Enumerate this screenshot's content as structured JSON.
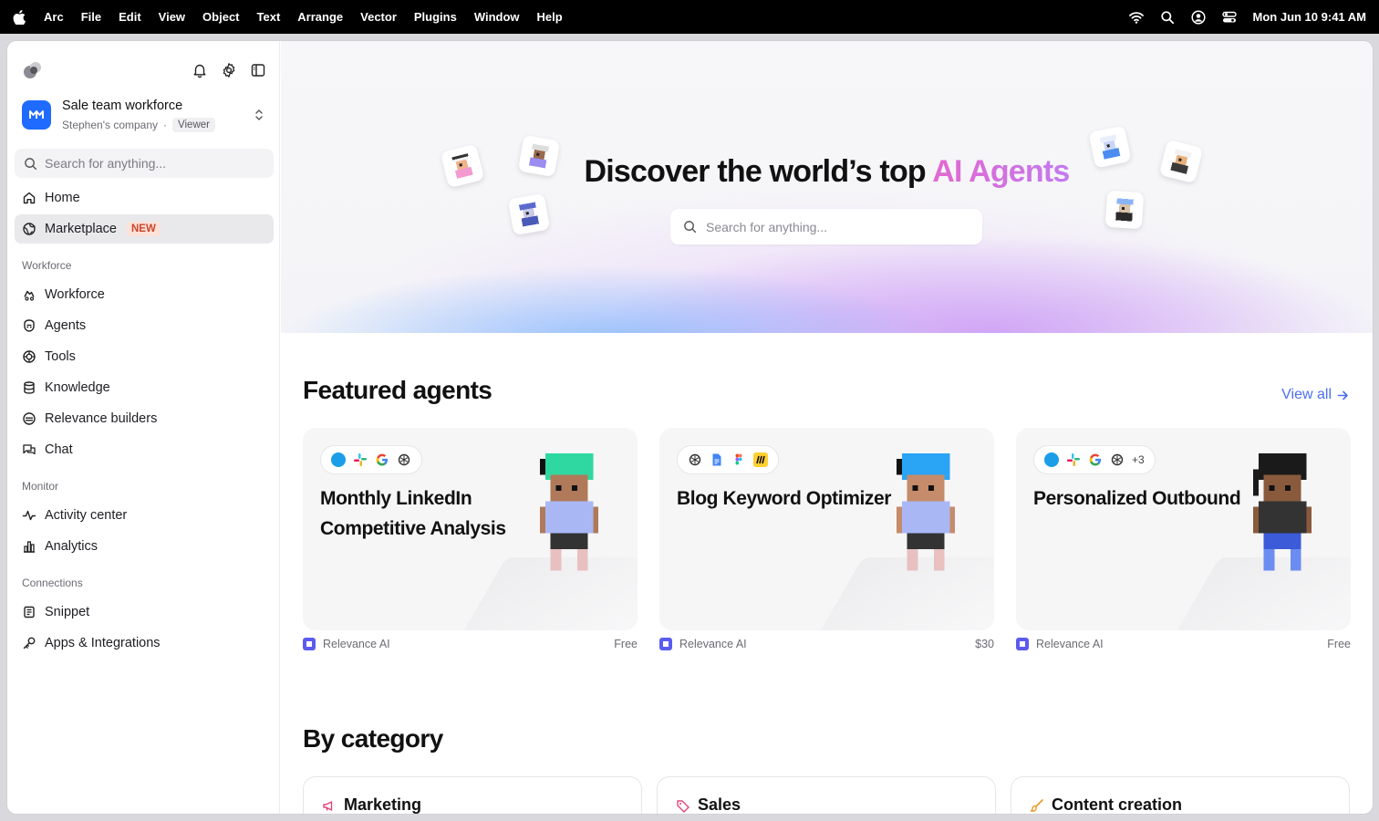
{
  "menubar": {
    "app_name": "Arc",
    "menus": [
      "File",
      "Edit",
      "View",
      "Object",
      "Text",
      "Arrange",
      "Vector",
      "Plugins",
      "Window",
      "Help"
    ],
    "clock": "Mon Jun 10  9:41 AM"
  },
  "sidebar": {
    "workspace": {
      "name": "Sale team workforce",
      "company": "Stephen's company",
      "separator": "·",
      "role": "Viewer"
    },
    "search_placeholder": "Search for anything...",
    "primary": [
      {
        "label": "Home",
        "icon": "home-icon"
      },
      {
        "label": "Marketplace",
        "icon": "globe-icon",
        "badge": "NEW",
        "active": true
      }
    ],
    "sections": [
      {
        "title": "Workforce",
        "items": [
          {
            "label": "Workforce",
            "icon": "workforce-icon"
          },
          {
            "label": "Agents",
            "icon": "agent-icon"
          },
          {
            "label": "Tools",
            "icon": "tool-icon"
          },
          {
            "label": "Knowledge",
            "icon": "database-icon"
          },
          {
            "label": "Relevance builders",
            "icon": "builders-icon"
          },
          {
            "label": "Chat",
            "icon": "chat-icon"
          }
        ]
      },
      {
        "title": "Monitor",
        "items": [
          {
            "label": "Activity center",
            "icon": "activity-icon"
          },
          {
            "label": "Analytics",
            "icon": "analytics-icon"
          }
        ]
      },
      {
        "title": "Connections",
        "items": [
          {
            "label": "Snippet",
            "icon": "snippet-icon"
          },
          {
            "label": "Apps & Integrations",
            "icon": "key-icon"
          }
        ]
      }
    ]
  },
  "hero": {
    "title_plain": "Discover the world’s top ",
    "title_accent": "AI Agents",
    "search_placeholder": "Search for anything..."
  },
  "featured": {
    "title": "Featured agents",
    "view_all": "View all",
    "cards": [
      {
        "title": "Monthly LinkedIn Competitive Analysis",
        "tools": [
          "salesforce",
          "slack",
          "google",
          "openai"
        ],
        "more": "",
        "publisher": "Relevance AI",
        "price": "Free",
        "hair_color": "#2fd8a0",
        "shirt_color": "#a9b8f5",
        "skin_color": "#b07a5a"
      },
      {
        "title": "Blog Keyword Optimizer",
        "tools": [
          "openai",
          "google-docs",
          "figma",
          "miro"
        ],
        "more": "",
        "publisher": "Relevance AI",
        "price": "$30",
        "hair_color": "#2aa4f5",
        "shirt_color": "#a9b8f5",
        "skin_color": "#c58b6a"
      },
      {
        "title": "Personalized Outbound",
        "tools": [
          "salesforce",
          "slack",
          "google",
          "openai"
        ],
        "more": "+3",
        "publisher": "Relevance AI",
        "price": "Free",
        "hair_color": "#1a1a1a",
        "shirt_color": "#333333",
        "skin_color": "#8a5a3c"
      }
    ]
  },
  "category": {
    "title": "By category",
    "items": [
      {
        "label": "Marketing",
        "icon": "megaphone-icon",
        "color": "#e0457b"
      },
      {
        "label": "Sales",
        "icon": "tag-icon",
        "color": "#e0457b"
      },
      {
        "label": "Content creation",
        "icon": "brush-icon",
        "color": "#e89a2a"
      }
    ]
  }
}
